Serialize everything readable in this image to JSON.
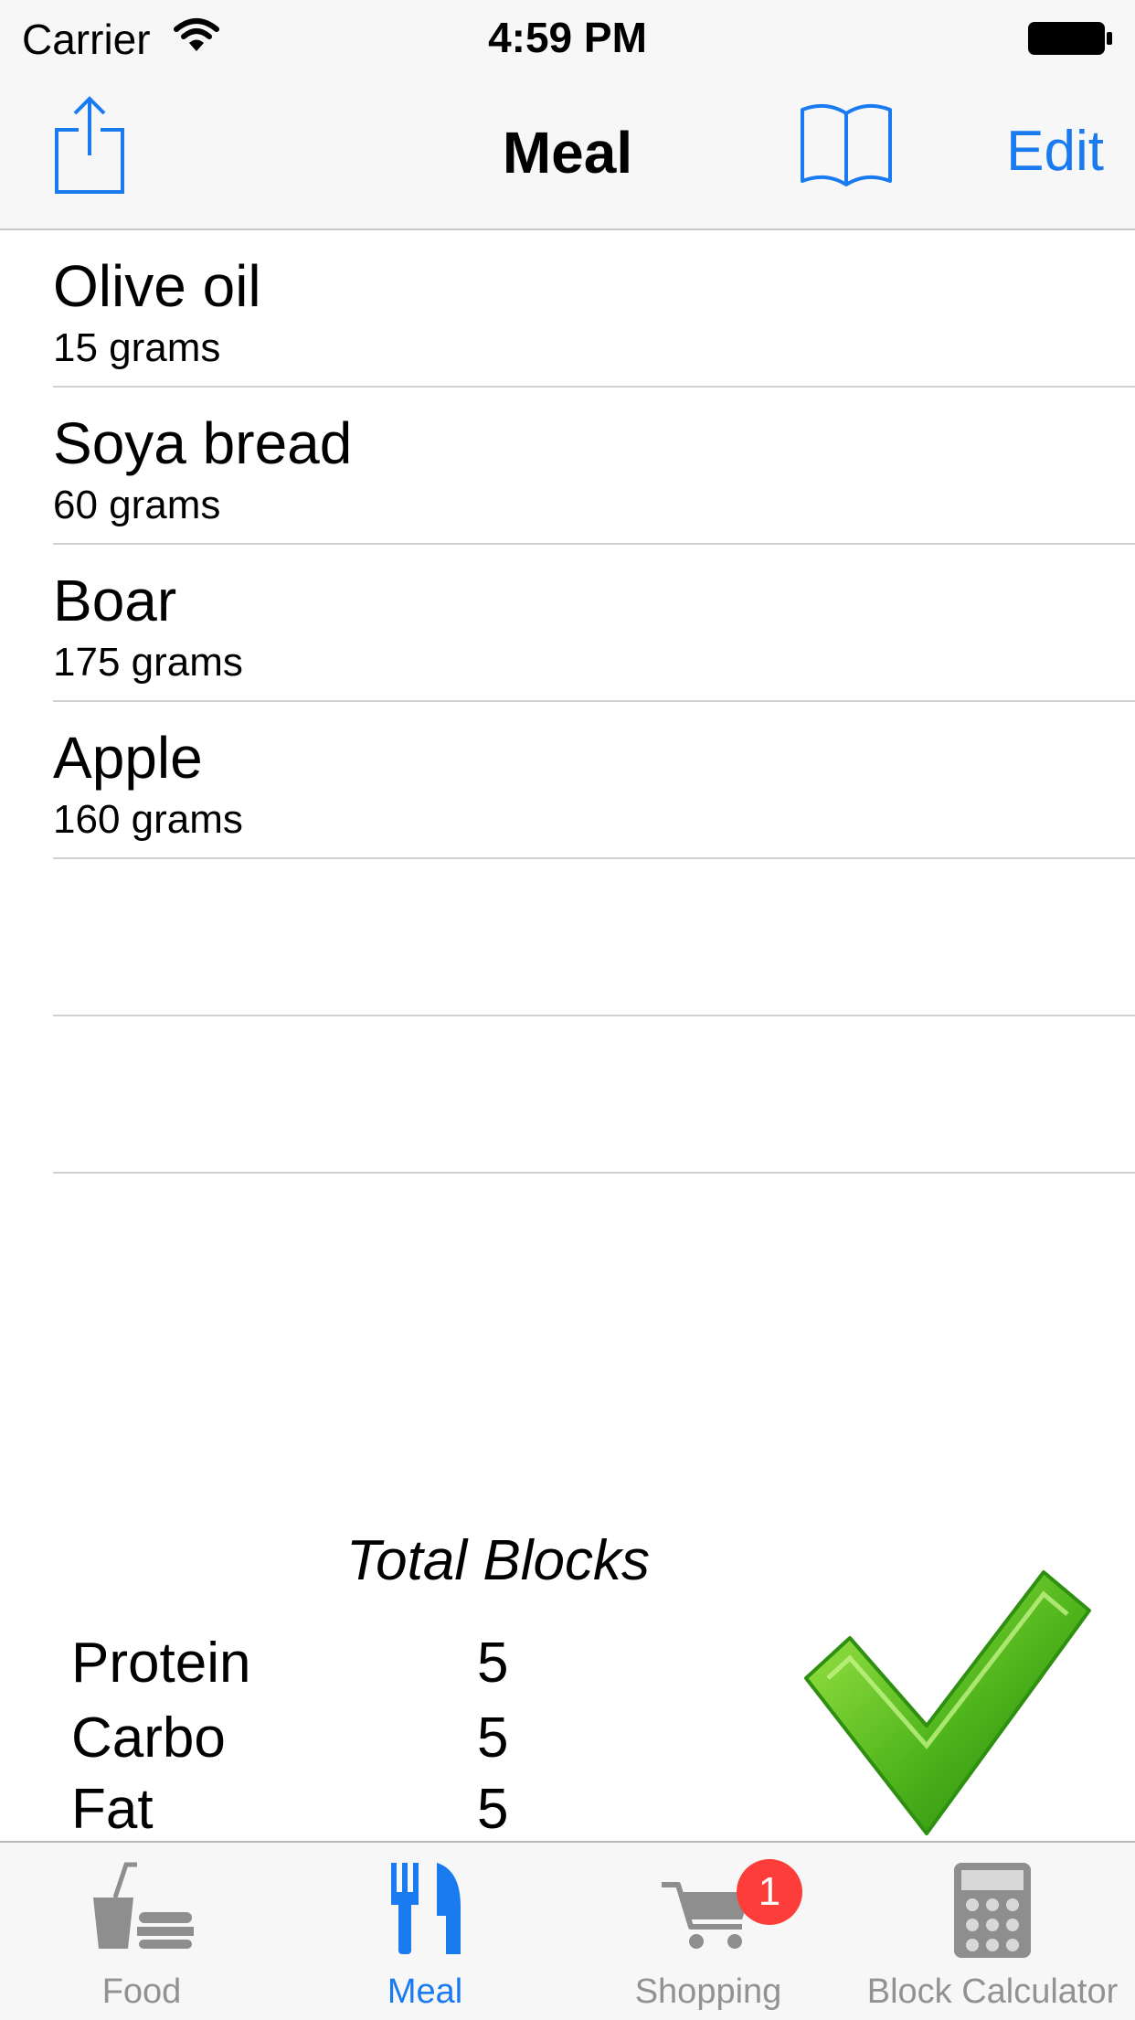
{
  "status_bar": {
    "carrier": "Carrier",
    "time": "4:59 PM"
  },
  "nav": {
    "title": "Meal",
    "edit_label": "Edit"
  },
  "foods": [
    {
      "name": "Olive oil",
      "quantity": "15 grams"
    },
    {
      "name": "Soya bread",
      "quantity": "60 grams"
    },
    {
      "name": "Boar",
      "quantity": "175 grams"
    },
    {
      "name": "Apple",
      "quantity": "160 grams"
    },
    {
      "name": "",
      "quantity": ""
    },
    {
      "name": "",
      "quantity": ""
    }
  ],
  "totals": {
    "title": "Total Blocks",
    "rows": [
      {
        "label": "Protein",
        "value": "5"
      },
      {
        "label": "Carbo",
        "value": "5"
      },
      {
        "label": "Fat",
        "value": "5"
      }
    ]
  },
  "tabs": [
    {
      "label": "Food",
      "icon": "food-drink-icon"
    },
    {
      "label": "Meal",
      "icon": "fork-knife-icon",
      "active": true
    },
    {
      "label": "Shopping",
      "icon": "cart-icon",
      "badge": "1"
    },
    {
      "label": "Block Calculator",
      "icon": "calculator-icon"
    }
  ],
  "colors": {
    "accent": "#1a7bf0",
    "badge": "#fc3d39",
    "check": "#4fb51c"
  }
}
